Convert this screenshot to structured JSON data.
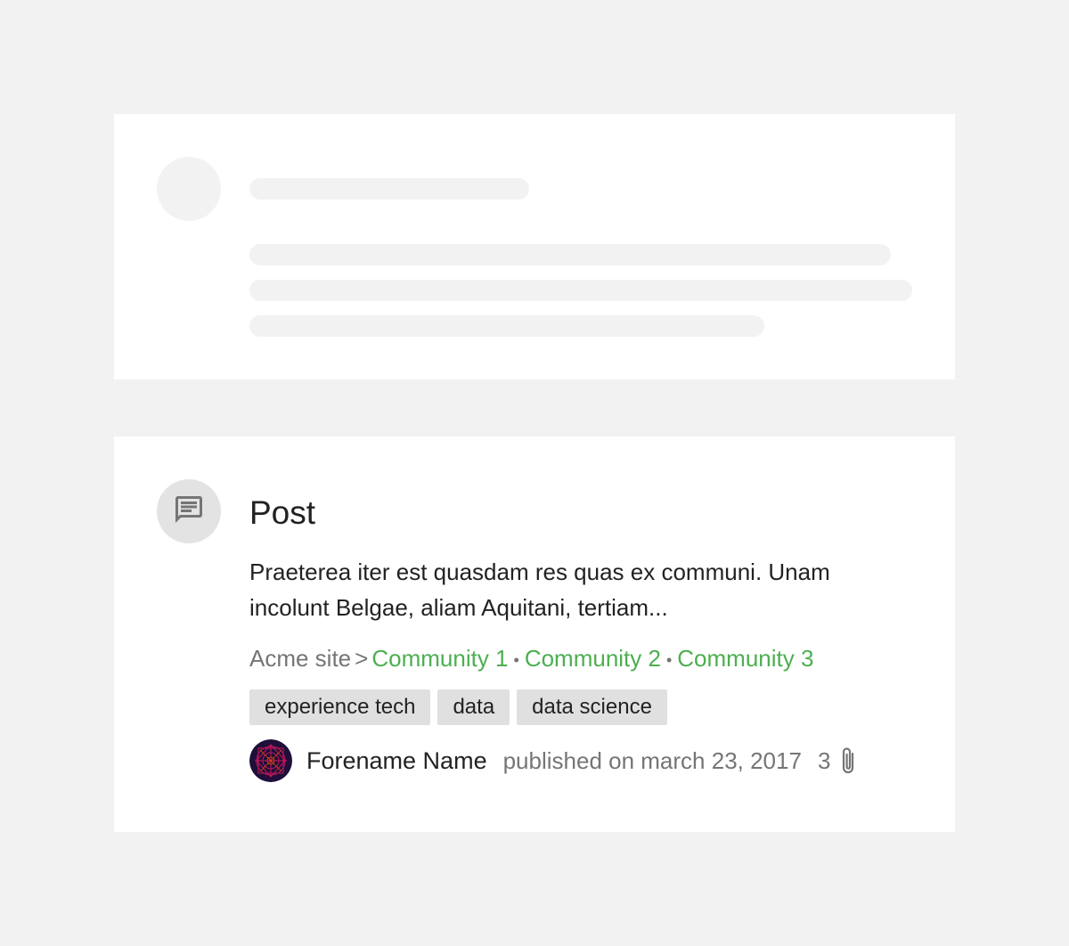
{
  "post": {
    "type_icon": "comment-icon",
    "title": "Post",
    "excerpt": "Praeterea iter est quasdam res quas ex communi. Unam incolunt Belgae, aliam Aquitani, tertiam...",
    "breadcrumb": {
      "site": "Acme site",
      "separator": ">",
      "dot": "•",
      "communities": [
        "Community 1",
        "Community 2",
        "Community 3"
      ]
    },
    "tags": [
      "experience tech",
      "data",
      "data science"
    ],
    "author": {
      "name": "Forename Name",
      "avatar_icon": "author-avatar-pattern"
    },
    "published": "published on march 23, 2017",
    "attachments": {
      "count": "3",
      "icon": "paperclip-icon"
    }
  },
  "colors": {
    "background": "#f2f2f2",
    "card": "#ffffff",
    "skeleton": "#f2f2f2",
    "link_green": "#4caf50",
    "muted_text": "#757575",
    "tag_bg": "#e0e0e0"
  }
}
